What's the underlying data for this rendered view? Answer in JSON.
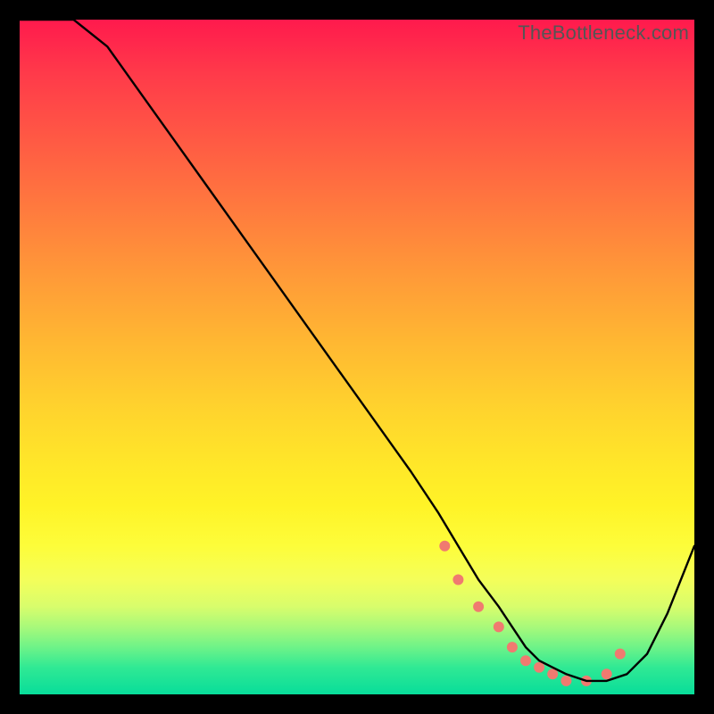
{
  "watermark": "TheBottleneck.com",
  "chart_data": {
    "type": "line",
    "title": "",
    "xlabel": "",
    "ylabel": "",
    "xlim": [
      0,
      100
    ],
    "ylim": [
      0,
      100
    ],
    "gradient_stops": [
      {
        "pct": 0,
        "color": "#ff1a4d"
      },
      {
        "pct": 8,
        "color": "#ff3a4a"
      },
      {
        "pct": 18,
        "color": "#ff5a44"
      },
      {
        "pct": 28,
        "color": "#ff7a3e"
      },
      {
        "pct": 38,
        "color": "#ff9a38"
      },
      {
        "pct": 48,
        "color": "#ffb832"
      },
      {
        "pct": 58,
        "color": "#ffd42d"
      },
      {
        "pct": 66,
        "color": "#ffe729"
      },
      {
        "pct": 72,
        "color": "#fff327"
      },
      {
        "pct": 78,
        "color": "#fdfd3a"
      },
      {
        "pct": 83,
        "color": "#f4fe5a"
      },
      {
        "pct": 87,
        "color": "#d8fd6c"
      },
      {
        "pct": 90,
        "color": "#a8f97a"
      },
      {
        "pct": 93,
        "color": "#6ef388"
      },
      {
        "pct": 96,
        "color": "#30e994"
      },
      {
        "pct": 100,
        "color": "#08dd9a"
      }
    ],
    "series": [
      {
        "name": "bottleneck-curve",
        "x": [
          0,
          3,
          8,
          13,
          18,
          23,
          28,
          33,
          38,
          43,
          48,
          53,
          58,
          62,
          65,
          68,
          71,
          73,
          75,
          77,
          79,
          81,
          84,
          87,
          90,
          93,
          96,
          100
        ],
        "y": [
          100,
          100,
          100,
          96,
          89,
          82,
          75,
          68,
          61,
          54,
          47,
          40,
          33,
          27,
          22,
          17,
          13,
          10,
          7,
          5,
          4,
          3,
          2,
          2,
          3,
          6,
          12,
          22
        ]
      }
    ],
    "markers": {
      "name": "highlight-points",
      "color": "#f07a70",
      "radius_px": 6,
      "x": [
        63,
        65,
        68,
        71,
        73,
        75,
        77,
        79,
        81,
        84,
        87,
        89
      ],
      "y": [
        22,
        17,
        13,
        10,
        7,
        5,
        4,
        3,
        2,
        2,
        3,
        6
      ]
    }
  }
}
